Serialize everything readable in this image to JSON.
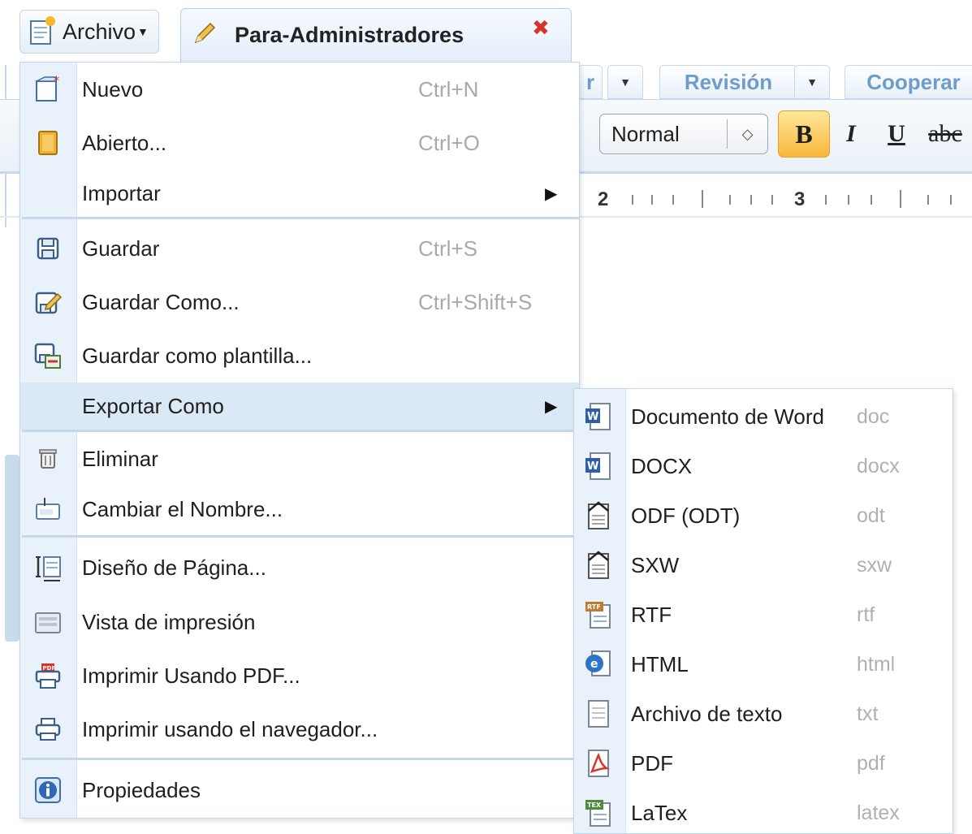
{
  "topbar": {
    "file_menu_label": "Archivo",
    "document_tab_title": "Para-Administradores"
  },
  "ribbon": {
    "tabs": [
      {
        "label": "r"
      },
      {
        "label": "Revisión"
      },
      {
        "label": "Cooperar"
      }
    ],
    "style_select_value": "Normal",
    "format_buttons": {
      "bold": "B",
      "italic": "I",
      "underline": "U",
      "strike": "abc"
    },
    "ruler_numbers": [
      "2",
      "3"
    ]
  },
  "file_menu": {
    "items": [
      {
        "label": "Nuevo",
        "shortcut": "Ctrl+N",
        "icon": "new-document-icon"
      },
      {
        "label": "Abierto...",
        "shortcut": "Ctrl+O",
        "icon": "open-folder-icon"
      },
      {
        "label": "Importar",
        "icon": "none",
        "submenu": true
      },
      {
        "label": "Guardar",
        "shortcut": "Ctrl+S",
        "icon": "save-icon"
      },
      {
        "label": "Guardar Como...",
        "shortcut": "Ctrl+Shift+S",
        "icon": "save-as-icon"
      },
      {
        "label": "Guardar como plantilla...",
        "icon": "save-template-icon"
      },
      {
        "label": "Exportar Como",
        "icon": "none",
        "submenu": true,
        "highlighted": true
      },
      {
        "label": "Eliminar",
        "icon": "trash-icon"
      },
      {
        "label": "Cambiar el Nombre...",
        "icon": "rename-icon"
      },
      {
        "label": "Diseño de Página...",
        "icon": "page-setup-icon"
      },
      {
        "label": "Vista de impresión",
        "icon": "print-preview-icon"
      },
      {
        "label": "Imprimir Usando PDF...",
        "icon": "print-pdf-icon"
      },
      {
        "label": "Imprimir usando el navegador...",
        "icon": "printer-icon"
      },
      {
        "label": "Propiedades",
        "icon": "info-icon"
      }
    ]
  },
  "export_menu": {
    "items": [
      {
        "label": "Documento de Word",
        "ext": "doc",
        "icon": "word-doc-icon"
      },
      {
        "label": "DOCX",
        "ext": "docx",
        "icon": "word-doc-icon"
      },
      {
        "label": "ODF (ODT)",
        "ext": "odt",
        "icon": "odf-doc-icon"
      },
      {
        "label": "SXW",
        "ext": "sxw",
        "icon": "odf-doc-icon"
      },
      {
        "label": "RTF",
        "ext": "rtf",
        "icon": "rtf-doc-icon"
      },
      {
        "label": "HTML",
        "ext": "html",
        "icon": "html-doc-icon"
      },
      {
        "label": "Archivo de texto",
        "ext": "txt",
        "icon": "text-doc-icon"
      },
      {
        "label": "PDF",
        "ext": "pdf",
        "icon": "pdf-doc-icon"
      },
      {
        "label": "LaTex",
        "ext": "latex",
        "icon": "latex-doc-icon"
      }
    ]
  },
  "colors": {
    "accent": "#6f9ccb",
    "highlight": "#dbe8f6",
    "close": "#d6332a",
    "bold_button": "#f8b73b"
  }
}
